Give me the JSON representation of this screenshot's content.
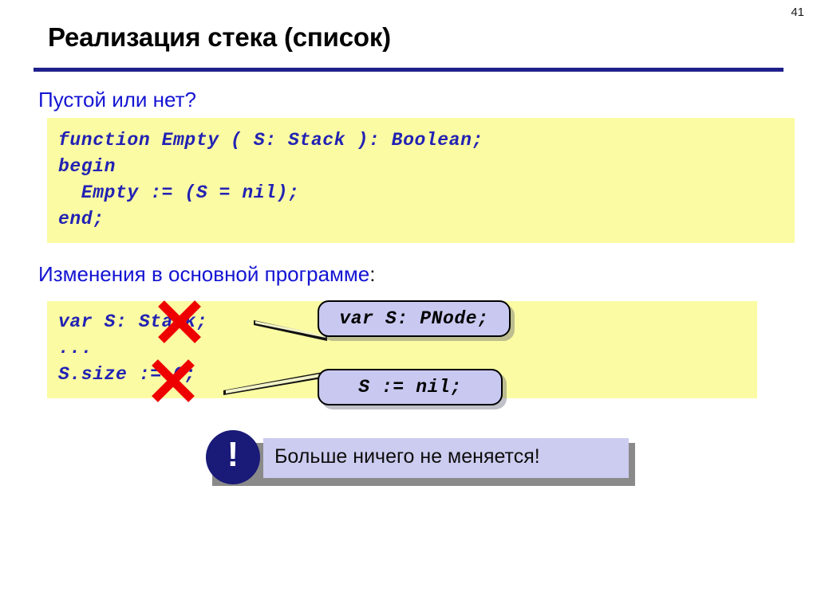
{
  "slide": {
    "number": "41",
    "title": "Реализация стека (список)",
    "accent_color": "#20208c",
    "heading_color": "#1414d2",
    "code_bg_color": "#fbfba3",
    "code_text_color": "#2222b4",
    "callout_bg_color": "#c8c8f0",
    "cross_color": "#ef0000"
  },
  "sections": {
    "empty": {
      "heading": "Пустой или нет?",
      "code": "function Empty ( S: Stack ): Boolean;\nbegin\n  Empty := (S = nil);\nend;"
    },
    "main": {
      "heading": "Изменения в основной программе",
      "heading_colon": ":",
      "code": "var S: Stack;\n...\nS.size := 0;",
      "crosses": [
        {
          "name": "cross-out-stack",
          "target": "Stack"
        },
        {
          "name": "cross-out-assign",
          "target": ":="
        }
      ],
      "callouts": [
        {
          "name": "callout-pnode",
          "text": "var S: PNode;"
        },
        {
          "name": "callout-nil",
          "text": "S := nil;"
        }
      ]
    }
  },
  "notice": {
    "icon": "exclamation-mark",
    "icon_glyph": "!",
    "text": "Больше ничего не меняется!"
  }
}
